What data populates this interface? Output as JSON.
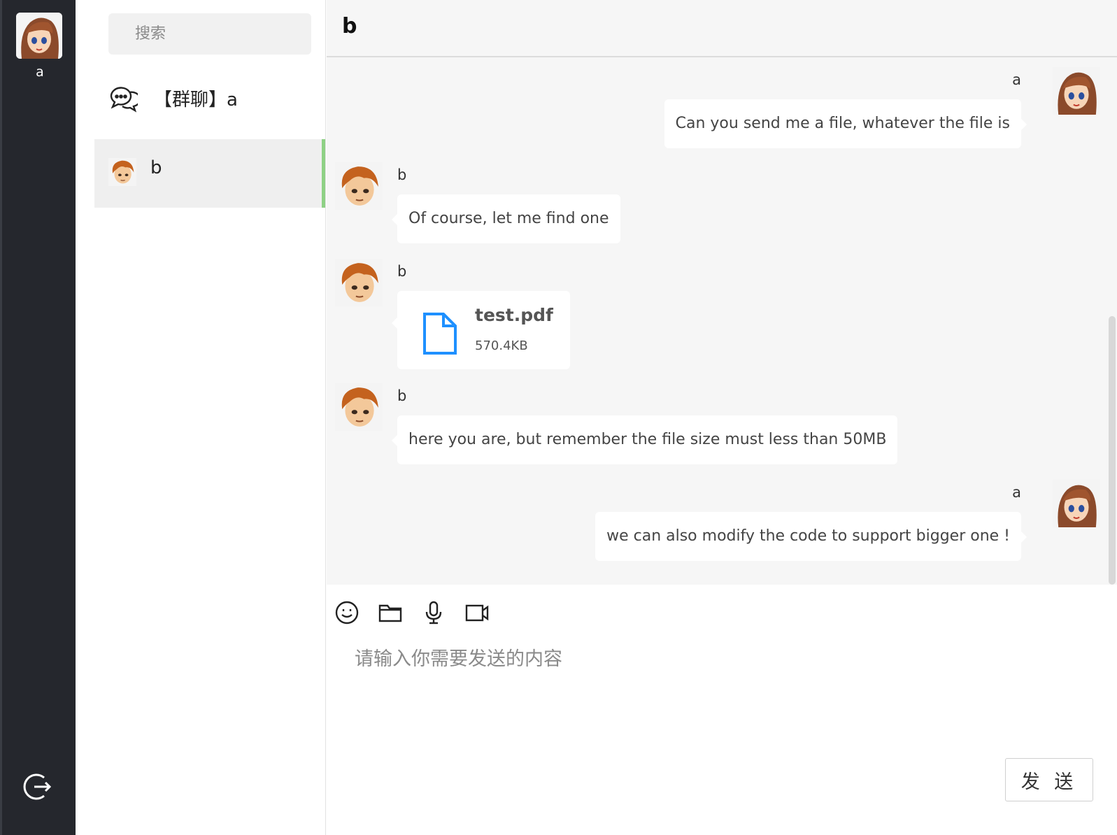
{
  "current_user": {
    "name": "a"
  },
  "sidebar": {
    "logout_icon": "logout-icon"
  },
  "session_list": {
    "search_placeholder": "搜索",
    "items": [
      {
        "label": "【群聊】a",
        "icon": "chat-bubbles-icon",
        "active": false
      },
      {
        "label": "b",
        "icon": "avatar",
        "active": true
      }
    ]
  },
  "chat": {
    "title": "b",
    "messages": [
      {
        "sender": "a",
        "side": "right",
        "type": "text",
        "text": "Can you send me a file, whatever the file is"
      },
      {
        "sender": "b",
        "side": "left",
        "type": "text",
        "text": "Of course, let me find one"
      },
      {
        "sender": "b",
        "side": "left",
        "type": "file",
        "file_name": "test.pdf",
        "file_size": "570.4KB",
        "icon": "file-icon"
      },
      {
        "sender": "b",
        "side": "left",
        "type": "text",
        "text": "here you are, but remember the file size must less than 50MB"
      },
      {
        "sender": "a",
        "side": "right",
        "type": "text",
        "text": "we can also modify the code to support bigger one !"
      }
    ]
  },
  "composer": {
    "tools": [
      "emoji-icon",
      "folder-icon",
      "microphone-icon",
      "video-camera-icon"
    ],
    "placeholder": "请输入你需要发送的内容",
    "send_label": "发 送"
  },
  "colors": {
    "rail_bg": "#25272d",
    "active_indicator": "#8ed185",
    "file_icon": "#1e90ff",
    "chat_bg": "#f6f6f6"
  }
}
